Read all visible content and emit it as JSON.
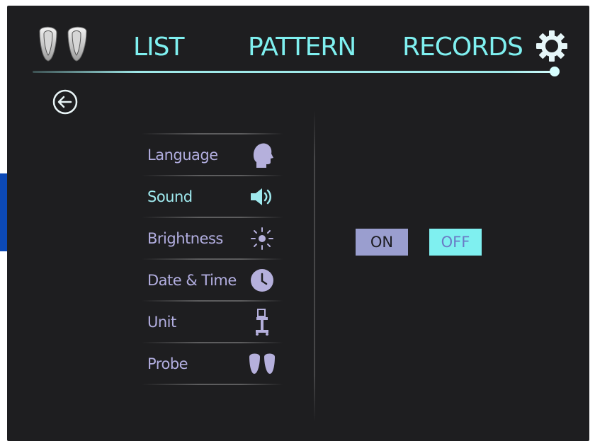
{
  "nav": {
    "list": "LIST",
    "pattern": "PATTERN",
    "records": "RECORDS"
  },
  "menu": {
    "items": [
      {
        "label": "Language",
        "icon": "head-profile-icon"
      },
      {
        "label": "Sound",
        "icon": "speaker-icon"
      },
      {
        "label": "Brightness",
        "icon": "sun-icon"
      },
      {
        "label": "Date & Time",
        "icon": "clock-icon"
      },
      {
        "label": "Unit",
        "icon": "device-stand-icon"
      },
      {
        "label": "Probe",
        "icon": "probe-pair-icon"
      }
    ],
    "active": "Sound"
  },
  "sound": {
    "on_label": "ON",
    "off_label": "OFF"
  },
  "colors": {
    "screen_bg": "#1e1e20",
    "accent_cyan": "#7ff0f0",
    "menu_text": "#b2aee0",
    "on_button": "#9a9ecf",
    "callout_blue": "#0c49b6"
  }
}
